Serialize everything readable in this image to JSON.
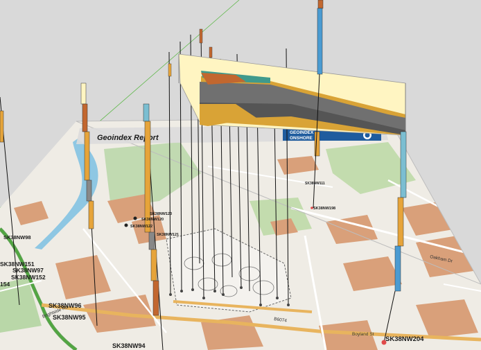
{
  "report": {
    "title": "Geoindex Report",
    "brand_line1": "GEOINDEX",
    "brand_line2": "ONSHORE"
  },
  "boreholes": {
    "large": [
      "SK38NW98",
      "SK38NW151",
      "SK38NW97",
      "SK38NW152",
      "154",
      "SK38NW96",
      "SK38NW95",
      "SK38NW94",
      "SK38NW204"
    ],
    "small": [
      "SK38NW198",
      "SK38NW122",
      "SK38NW121",
      "SK38NW120",
      "SK38NW123",
      "SK38NW111"
    ]
  },
  "roads": {
    "road_1": "Brightside Rd",
    "road_2": "Boyland St",
    "road_3": "Oakham Dr",
    "road_4": "B6074"
  },
  "colors": {
    "background": "#d9d9d9",
    "map_base": "#efece5",
    "water": "#8ec7e3",
    "park": "#b9d7a8",
    "building": "#d9a07a",
    "section_top": "#fff5c2",
    "section_dark": "#555555",
    "section_orange": "#d9a336",
    "borehole_blue": "#4a9bd1",
    "borehole_orange": "#e6a43a"
  }
}
